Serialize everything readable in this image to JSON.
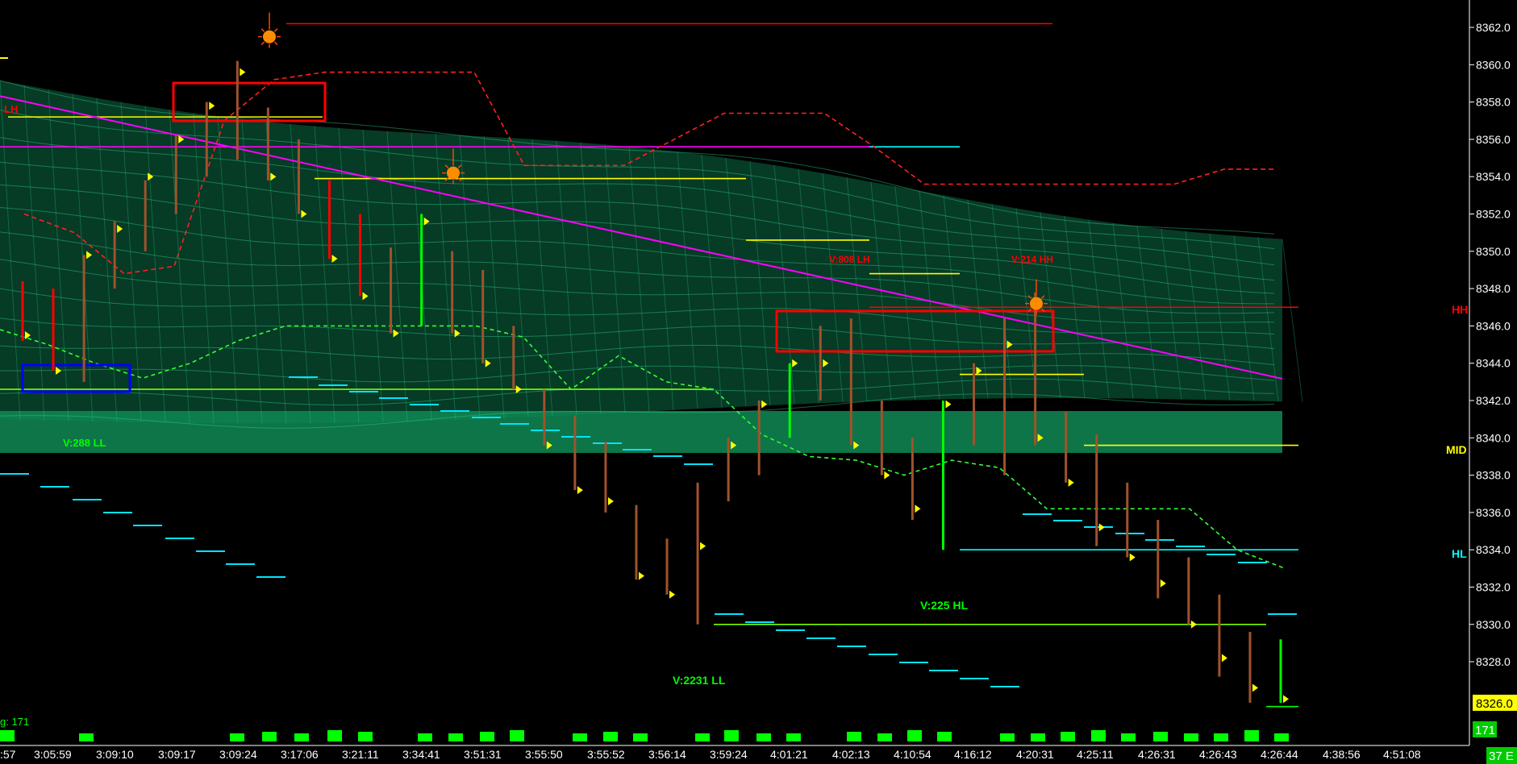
{
  "chart_data": {
    "type": "bar",
    "ylim": [
      8324.6,
      8363.2
    ],
    "y_ticks": [
      8362.0,
      8360.0,
      8358.0,
      8356.0,
      8354.0,
      8352.0,
      8350.0,
      8348.0,
      8346.0,
      8344.0,
      8342.0,
      8340.0,
      8338.0,
      8336.0,
      8334.0,
      8332.0,
      8330.0,
      8328.0
    ],
    "current_price": "8326.0",
    "volume_readout": "171",
    "volume_label": "g: 171",
    "right_edge_label": "37 E",
    "x_ticks": [
      ":57",
      "3:05:59",
      "3:09:10",
      "3:09:17",
      "3:09:24",
      "3:17:06",
      "3:21:11",
      "3:34:41",
      "3:51:31",
      "3:55:50",
      "3:55:52",
      "3:56:14",
      "3:59:24",
      "4:01:21",
      "4:02:13",
      "4:10:54",
      "4:16:12",
      "4:20:31",
      "4:25:11",
      "4:26:31",
      "4:26:43",
      "4:26:44",
      "4:38:56",
      "4:51:08"
    ],
    "bars": [
      {
        "high": 8348.4,
        "low": 8345.2,
        "close": 8345.5,
        "color": "#ff0000"
      },
      {
        "high": 8348.0,
        "low": 8343.6,
        "close": 8343.6,
        "color": "#ff0000"
      },
      {
        "high": 8349.8,
        "low": 8343.0,
        "close": 8349.8,
        "color": "#a0522d"
      },
      {
        "high": 8351.6,
        "low": 8348.0,
        "close": 8351.2,
        "color": "#a0522d"
      },
      {
        "high": 8353.8,
        "low": 8350.0,
        "close": 8354.0,
        "color": "#a0522d"
      },
      {
        "high": 8356.2,
        "low": 8352.0,
        "close": 8356.0,
        "color": "#a0522d"
      },
      {
        "high": 8358.0,
        "low": 8354.0,
        "close": 8357.8,
        "color": "#a0522d"
      },
      {
        "high": 8360.2,
        "low": 8354.9,
        "close": 8359.6,
        "color": "#a0522d"
      },
      {
        "high": 8357.7,
        "low": 8353.8,
        "close": 8354.0,
        "color": "#a0522d"
      },
      {
        "high": 8356.0,
        "low": 8352.0,
        "close": 8352.0,
        "color": "#a0522d"
      },
      {
        "high": 8353.8,
        "low": 8349.6,
        "close": 8349.6,
        "color": "#ff0000"
      },
      {
        "high": 8352.0,
        "low": 8347.6,
        "close": 8347.6,
        "color": "#ff0000"
      },
      {
        "high": 8350.2,
        "low": 8345.6,
        "close": 8345.6,
        "color": "#a0522d"
      },
      {
        "high": 8352.0,
        "low": 8346.0,
        "close": 8351.6,
        "color": "#00ff00"
      },
      {
        "high": 8350.0,
        "low": 8345.6,
        "close": 8345.6,
        "color": "#a0522d"
      },
      {
        "high": 8349.0,
        "low": 8344.0,
        "close": 8344.0,
        "color": "#a0522d"
      },
      {
        "high": 8346.0,
        "low": 8342.6,
        "close": 8342.6,
        "color": "#a0522d"
      },
      {
        "high": 8342.6,
        "low": 8339.6,
        "close": 8339.6,
        "color": "#a0522d"
      },
      {
        "high": 8341.2,
        "low": 8337.2,
        "close": 8337.2,
        "color": "#a0522d"
      },
      {
        "high": 8339.8,
        "low": 8336.0,
        "close": 8336.6,
        "color": "#a0522d"
      },
      {
        "high": 8336.4,
        "low": 8332.4,
        "close": 8332.6,
        "color": "#a0522d"
      },
      {
        "high": 8334.6,
        "low": 8331.6,
        "close": 8331.6,
        "color": "#a0522d"
      },
      {
        "high": 8337.6,
        "low": 8330.0,
        "close": 8334.2,
        "color": "#a0522d"
      },
      {
        "high": 8340.0,
        "low": 8336.6,
        "close": 8339.6,
        "color": "#a0522d"
      },
      {
        "high": 8342.0,
        "low": 8338.0,
        "close": 8341.8,
        "color": "#a0522d"
      },
      {
        "high": 8344.0,
        "low": 8340.0,
        "close": 8344.0,
        "color": "#00ff00"
      },
      {
        "high": 8346.0,
        "low": 8342.0,
        "close": 8344.0,
        "color": "#a0522d"
      },
      {
        "high": 8346.4,
        "low": 8339.6,
        "close": 8339.6,
        "color": "#a0522d"
      },
      {
        "high": 8342.0,
        "low": 8338.0,
        "close": 8338.0,
        "color": "#a0522d"
      },
      {
        "high": 8340.0,
        "low": 8335.6,
        "close": 8336.2,
        "color": "#a0522d"
      },
      {
        "high": 8342.0,
        "low": 8334.0,
        "close": 8341.8,
        "color": "#00ff00"
      },
      {
        "high": 8344.0,
        "low": 8339.6,
        "close": 8343.6,
        "color": "#a0522d"
      },
      {
        "high": 8346.4,
        "low": 8338.0,
        "close": 8345.0,
        "color": "#a0522d"
      },
      {
        "high": 8347.8,
        "low": 8339.6,
        "close": 8340.0,
        "color": "#a0522d"
      },
      {
        "high": 8341.4,
        "low": 8337.6,
        "close": 8337.6,
        "color": "#a0522d"
      },
      {
        "high": 8340.2,
        "low": 8334.2,
        "close": 8335.2,
        "color": "#a0522d"
      },
      {
        "high": 8337.6,
        "low": 8333.6,
        "close": 8333.6,
        "color": "#a0522d"
      },
      {
        "high": 8335.6,
        "low": 8331.4,
        "close": 8332.2,
        "color": "#a0522d"
      },
      {
        "high": 8333.6,
        "low": 8330.0,
        "close": 8330.0,
        "color": "#a0522d"
      },
      {
        "high": 8331.6,
        "low": 8327.2,
        "close": 8328.2,
        "color": "#a0522d"
      },
      {
        "high": 8329.6,
        "low": 8325.8,
        "close": 8326.6,
        "color": "#a0522d"
      },
      {
        "high": 8329.2,
        "low": 8325.8,
        "close": 8326.0,
        "color": "#00ff00"
      }
    ],
    "level_labels": [
      {
        "text": "LH",
        "color": "#ff0000"
      },
      {
        "text": "HH",
        "color": "#ff0000",
        "price": 8347.0
      },
      {
        "text": "MID",
        "color": "#ffff00",
        "price": 8339.6
      },
      {
        "text": "HL",
        "color": "#00ffff",
        "price": 8334.0
      }
    ],
    "annotations": [
      {
        "text": "V:288 LL",
        "color": "#00ff00"
      },
      {
        "text": "V:808 LH",
        "color": "#ff0000"
      },
      {
        "text": "V:214 HH",
        "color": "#ff0000"
      },
      {
        "text": "V:225 HL",
        "color": "#00ff00"
      },
      {
        "text": "V:2231 LL",
        "color": "#00ff00"
      }
    ],
    "horizontal_lines": [
      {
        "price": 8362.2,
        "color": "#ff0000",
        "style": "solid"
      },
      {
        "price": 8357.2,
        "color": "#ffff00",
        "style": "solid"
      },
      {
        "price": 8355.6,
        "color": "#ff00ff",
        "style": "solid"
      },
      {
        "price": 8355.6,
        "color": "#00ffff",
        "style": "solid"
      },
      {
        "price": 8353.9,
        "color": "#ffff00",
        "style": "solid"
      },
      {
        "price": 8350.6,
        "color": "#ffff00",
        "style": "solid"
      },
      {
        "price": 8348.8,
        "color": "#ffff00",
        "style": "solid"
      },
      {
        "price": 8347.0,
        "color": "#ff0000",
        "style": "solid"
      },
      {
        "price": 8343.4,
        "color": "#ffff00",
        "style": "solid"
      },
      {
        "price": 8342.6,
        "color": "#7cfc00",
        "style": "solid"
      },
      {
        "price": 8339.6,
        "color": "#ffff00",
        "style": "solid"
      },
      {
        "price": 8334.0,
        "color": "#00ffff",
        "style": "solid"
      },
      {
        "price": 8330.0,
        "color": "#7cfc00",
        "style": "solid"
      },
      {
        "price": 8325.6,
        "color": "#00ff00",
        "style": "solid"
      }
    ],
    "trend_line": {
      "from": 8357.8,
      "to": 8343.6,
      "color": "#ff00ff"
    },
    "red_dashed_series": [
      8352.0,
      8351.0,
      8348.8,
      8349.2,
      8357.0,
      8359.2,
      8359.6,
      8359.6,
      8359.6,
      8359.6,
      8354.6,
      8354.6,
      8354.6,
      8356.0,
      8357.4,
      8357.4,
      8357.4,
      8355.6,
      8353.6,
      8353.6,
      8353.6,
      8353.6,
      8353.6,
      8353.6,
      8354.4,
      8354.4
    ],
    "green_dashed_series": [
      8345.8,
      8345.0,
      8344.0,
      8343.2,
      8344.0,
      8345.2,
      8346.0,
      8346.0,
      8346.0,
      8346.0,
      8346.0,
      8345.4,
      8342.6,
      8344.4,
      8343.0,
      8342.6,
      8340.2,
      8339.0,
      8338.8,
      8338.0,
      8338.8,
      8338.4,
      8336.2,
      8336.2,
      8336.2,
      8336.2,
      8334.0,
      8333.0
    ]
  }
}
